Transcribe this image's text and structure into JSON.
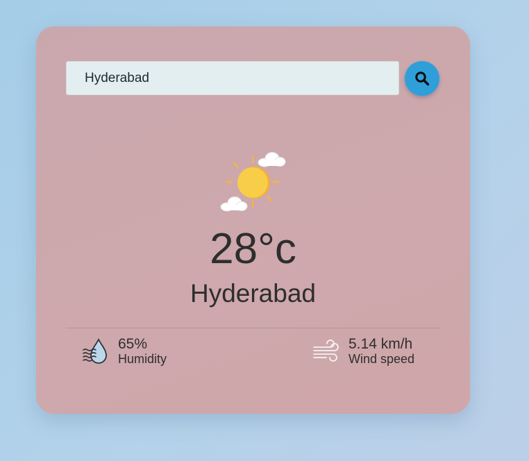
{
  "search": {
    "value": "Hyderabad",
    "icon": "search-icon"
  },
  "weather": {
    "icon": "sun-with-clouds-icon",
    "temperature": "28°c",
    "city": "Hyderabad"
  },
  "details": {
    "humidity": {
      "icon": "humidity-icon",
      "value": "65%",
      "label": "Humidity"
    },
    "wind": {
      "icon": "wind-icon",
      "value": "5.14 km/h",
      "label": "Wind speed"
    }
  },
  "colors": {
    "background": "#a5cde8",
    "card": "#cea8ac",
    "search_button": "#2f9fd9",
    "input": "#e2eef0",
    "text": "#2e2e2e",
    "sun": "#f7c843"
  }
}
